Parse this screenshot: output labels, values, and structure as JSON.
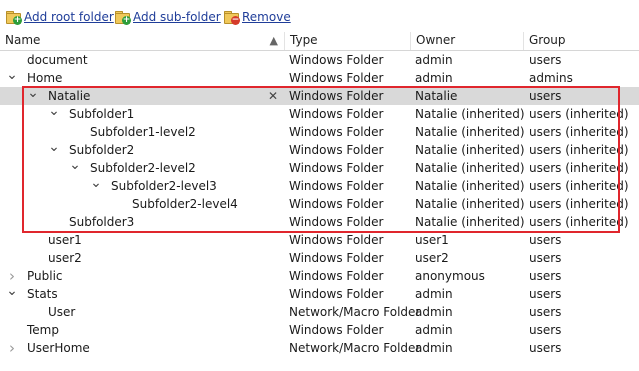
{
  "toolbar": {
    "add_root_label": "Add root folder",
    "add_sub_label": "Add sub-folder",
    "remove_label": "Remove"
  },
  "columns": {
    "name": "Name",
    "type": "Type",
    "owner": "Owner",
    "group": "Group"
  },
  "rows": [
    {
      "name": "document",
      "type": "Windows Folder",
      "owner": "admin",
      "group": "users",
      "level": 0,
      "expander": "none"
    },
    {
      "name": "Home",
      "type": "Windows Folder",
      "owner": "admin",
      "group": "admins",
      "level": 0,
      "expander": "open"
    },
    {
      "name": "Natalie",
      "type": "Windows Folder",
      "owner": "Natalie",
      "group": "users",
      "level": 1,
      "expander": "open",
      "selected": true
    },
    {
      "name": "Subfolder1",
      "type": "Windows Folder",
      "owner": "Natalie (inherited)",
      "group": "users (inherited)",
      "level": 2,
      "expander": "open"
    },
    {
      "name": "Subfolder1-level2",
      "type": "Windows Folder",
      "owner": "Natalie (inherited)",
      "group": "users (inherited)",
      "level": 3,
      "expander": "none"
    },
    {
      "name": "Subfolder2",
      "type": "Windows Folder",
      "owner": "Natalie (inherited)",
      "group": "users (inherited)",
      "level": 2,
      "expander": "open"
    },
    {
      "name": "Subfolder2-level2",
      "type": "Windows Folder",
      "owner": "Natalie (inherited)",
      "group": "users (inherited)",
      "level": 3,
      "expander": "open"
    },
    {
      "name": "Subfolder2-level3",
      "type": "Windows Folder",
      "owner": "Natalie (inherited)",
      "group": "users (inherited)",
      "level": 4,
      "expander": "open"
    },
    {
      "name": "Subfolder2-level4",
      "type": "Windows Folder",
      "owner": "Natalie (inherited)",
      "group": "users (inherited)",
      "level": 5,
      "expander": "none"
    },
    {
      "name": "Subfolder3",
      "type": "Windows Folder",
      "owner": "Natalie (inherited)",
      "group": "users (inherited)",
      "level": 2,
      "expander": "none"
    },
    {
      "name": "user1",
      "type": "Windows Folder",
      "owner": "user1",
      "group": "users",
      "level": 1,
      "expander": "none"
    },
    {
      "name": "user2",
      "type": "Windows Folder",
      "owner": "user2",
      "group": "users",
      "level": 1,
      "expander": "none"
    },
    {
      "name": "Public",
      "type": "Windows Folder",
      "owner": "anonymous",
      "group": "users",
      "level": 0,
      "expander": "closed"
    },
    {
      "name": "Stats",
      "type": "Windows Folder",
      "owner": "admin",
      "group": "users",
      "level": 0,
      "expander": "open"
    },
    {
      "name": "User",
      "type": "Network/Macro Folder",
      "owner": "admin",
      "group": "users",
      "level": 1,
      "expander": "none"
    },
    {
      "name": "Temp",
      "type": "Windows Folder",
      "owner": "admin",
      "group": "users",
      "level": 0,
      "expander": "none"
    },
    {
      "name": "UserHome",
      "type": "Network/Macro Folder",
      "owner": "admin",
      "group": "users",
      "level": 0,
      "expander": "closed"
    }
  ],
  "icons": {
    "add_root": "folder-add-icon",
    "add_sub": "subfolder-add-icon",
    "remove": "folder-remove-icon",
    "sort": "sort-ascending-icon",
    "expand": "chevron-down-icon",
    "collapse": "chevron-right-icon",
    "clear": "close-icon"
  },
  "colors": {
    "link": "#1f3d99",
    "selection": "#d9d9d9",
    "highlight_border": "#e0262d"
  }
}
